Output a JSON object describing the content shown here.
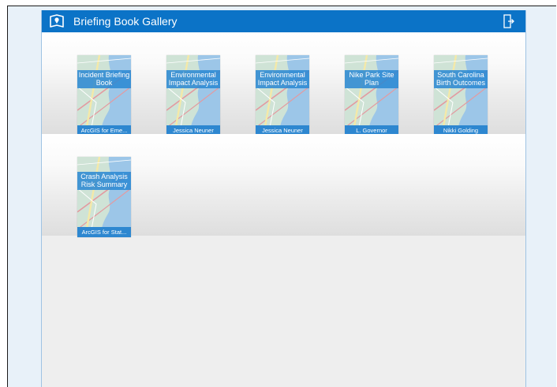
{
  "header": {
    "title": "Briefing Book Gallery",
    "icon": "book-map-icon",
    "exit_icon": "exit-icon",
    "color": "#0b73c7"
  },
  "gallery": {
    "rows": [
      [
        {
          "title": "Incident Briefing Book",
          "author": "ArcGIS for Eme..."
        },
        {
          "title": "Environmental Impact Analysis",
          "author": "Jessica Neuner"
        },
        {
          "title": "Environmental Impact Analysis",
          "author": "Jessica Neuner"
        },
        {
          "title": "Nike Park Site Plan",
          "author": "L. Governor"
        },
        {
          "title": "South Carolina Birth Outcomes",
          "author": "Nikki Golding"
        }
      ],
      [
        {
          "title": "Crash Analysis Risk Summary",
          "author": "ArcGIS for Stat..."
        }
      ]
    ]
  },
  "colors": {
    "card_label": "#2d87d0",
    "map_water": "#9cc6e8",
    "map_land": "#cfe3d6"
  }
}
